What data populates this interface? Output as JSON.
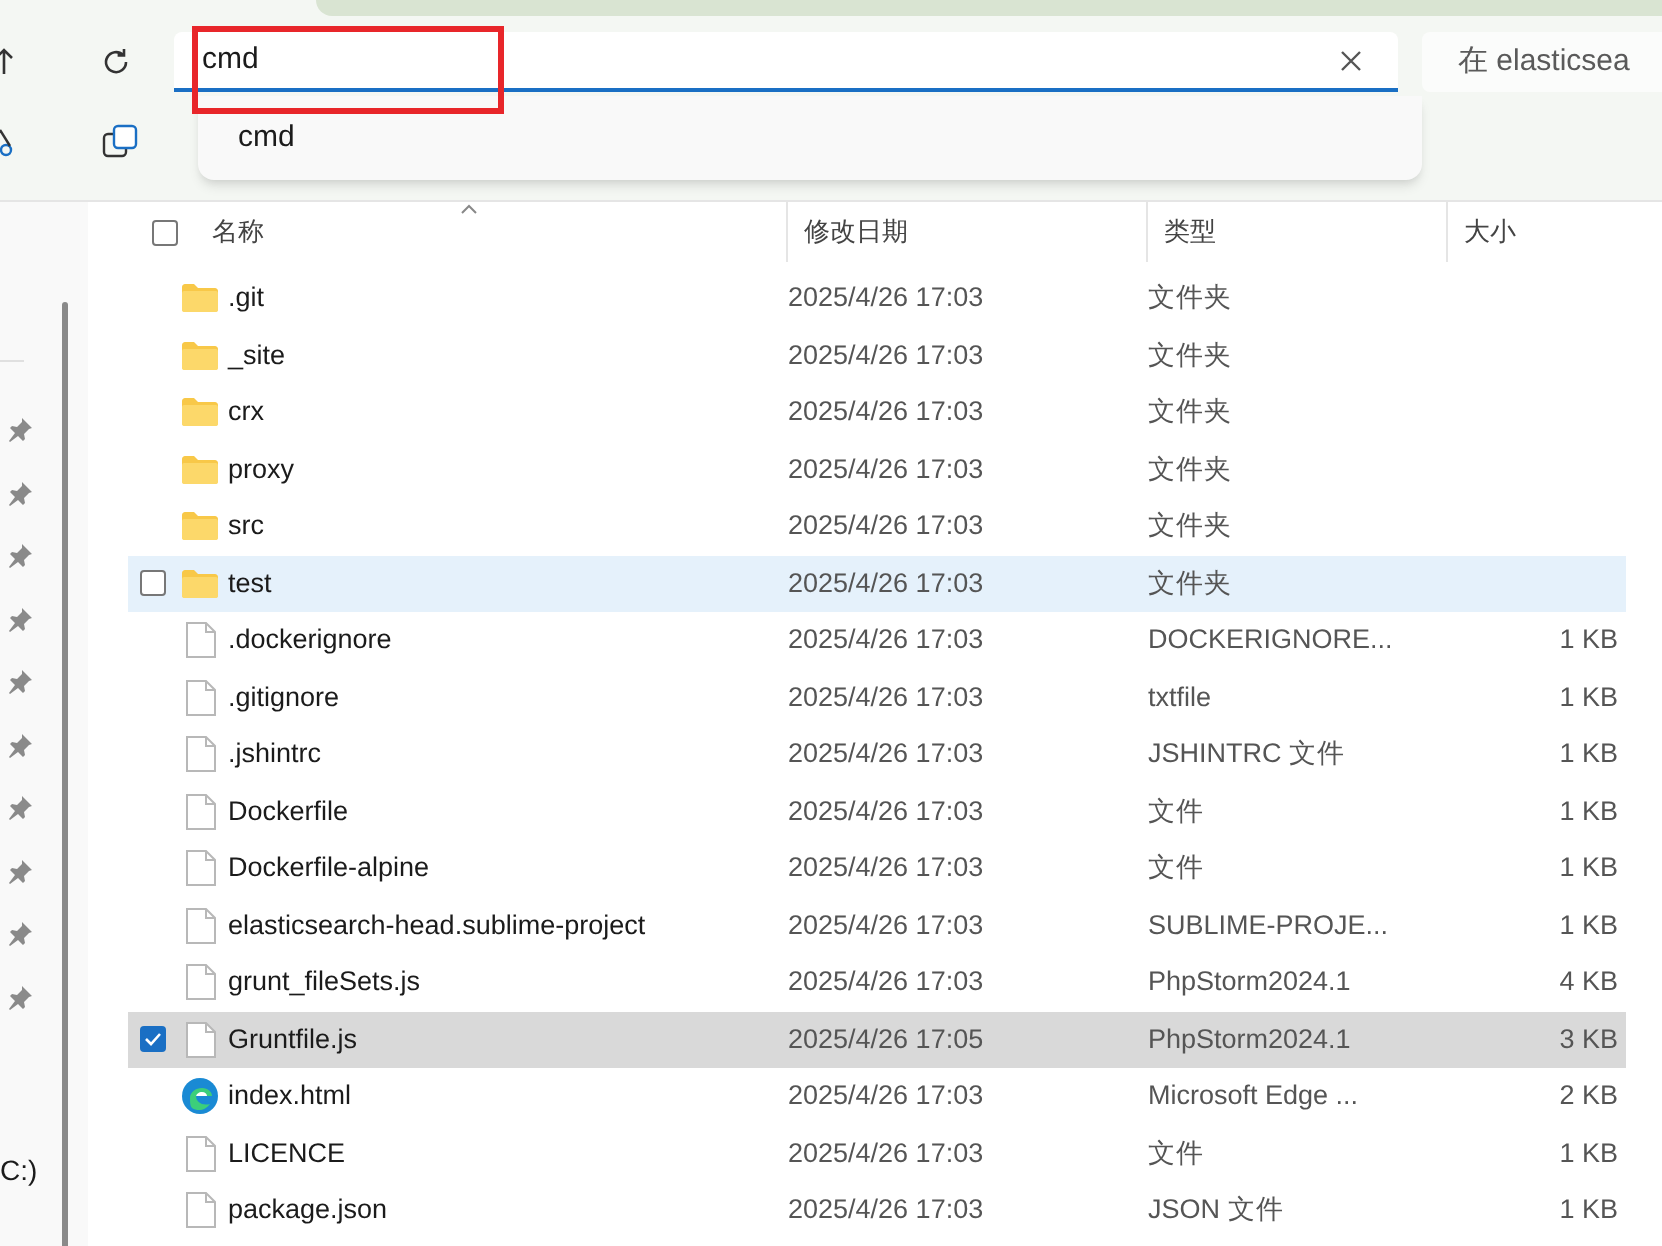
{
  "address": {
    "value": "cmd",
    "suggestions": [
      "cmd"
    ]
  },
  "search": {
    "placeholder": "在 elasticsea"
  },
  "nav": {
    "drive_label": "C:)"
  },
  "columns": [
    "名称",
    "修改日期",
    "类型",
    "大小"
  ],
  "header_checked": false,
  "rows": [
    {
      "kind": "folder",
      "name": ".git",
      "date": "2025/4/26 17:03",
      "type": "文件夹",
      "size": "",
      "hovered": false,
      "checked": false
    },
    {
      "kind": "folder",
      "name": "_site",
      "date": "2025/4/26 17:03",
      "type": "文件夹",
      "size": "",
      "hovered": false,
      "checked": false
    },
    {
      "kind": "folder",
      "name": "crx",
      "date": "2025/4/26 17:03",
      "type": "文件夹",
      "size": "",
      "hovered": false,
      "checked": false
    },
    {
      "kind": "folder",
      "name": "proxy",
      "date": "2025/4/26 17:03",
      "type": "文件夹",
      "size": "",
      "hovered": false,
      "checked": false
    },
    {
      "kind": "folder",
      "name": "src",
      "date": "2025/4/26 17:03",
      "type": "文件夹",
      "size": "",
      "hovered": false,
      "checked": false
    },
    {
      "kind": "folder",
      "name": "test",
      "date": "2025/4/26 17:03",
      "type": "文件夹",
      "size": "",
      "hovered": true,
      "checked": false
    },
    {
      "kind": "file",
      "name": ".dockerignore",
      "date": "2025/4/26 17:03",
      "type": "DOCKERIGNORE...",
      "size": "1 KB",
      "hovered": false,
      "checked": false
    },
    {
      "kind": "file",
      "name": ".gitignore",
      "date": "2025/4/26 17:03",
      "type": "txtfile",
      "size": "1 KB",
      "hovered": false,
      "checked": false
    },
    {
      "kind": "file",
      "name": ".jshintrc",
      "date": "2025/4/26 17:03",
      "type": "JSHINTRC 文件",
      "size": "1 KB",
      "hovered": false,
      "checked": false
    },
    {
      "kind": "file",
      "name": "Dockerfile",
      "date": "2025/4/26 17:03",
      "type": "文件",
      "size": "1 KB",
      "hovered": false,
      "checked": false
    },
    {
      "kind": "file",
      "name": "Dockerfile-alpine",
      "date": "2025/4/26 17:03",
      "type": "文件",
      "size": "1 KB",
      "hovered": false,
      "checked": false
    },
    {
      "kind": "file",
      "name": "elasticsearch-head.sublime-project",
      "date": "2025/4/26 17:03",
      "type": "SUBLIME-PROJE...",
      "size": "1 KB",
      "hovered": false,
      "checked": false
    },
    {
      "kind": "file",
      "name": "grunt_fileSets.js",
      "date": "2025/4/26 17:03",
      "type": "PhpStorm2024.1",
      "size": "4 KB",
      "hovered": false,
      "checked": false
    },
    {
      "kind": "file",
      "name": "Gruntfile.js",
      "date": "2025/4/26 17:05",
      "type": "PhpStorm2024.1",
      "size": "3 KB",
      "hovered": false,
      "checked": true
    },
    {
      "kind": "edge",
      "name": "index.html",
      "date": "2025/4/26 17:03",
      "type": "Microsoft Edge ...",
      "size": "2 KB",
      "hovered": false,
      "checked": false
    },
    {
      "kind": "file",
      "name": "LICENCE",
      "date": "2025/4/26 17:03",
      "type": "文件",
      "size": "1 KB",
      "hovered": false,
      "checked": false
    },
    {
      "kind": "file",
      "name": "package.json",
      "date": "2025/4/26 17:03",
      "type": "JSON 文件",
      "size": "1 KB",
      "hovered": false,
      "checked": false
    }
  ]
}
